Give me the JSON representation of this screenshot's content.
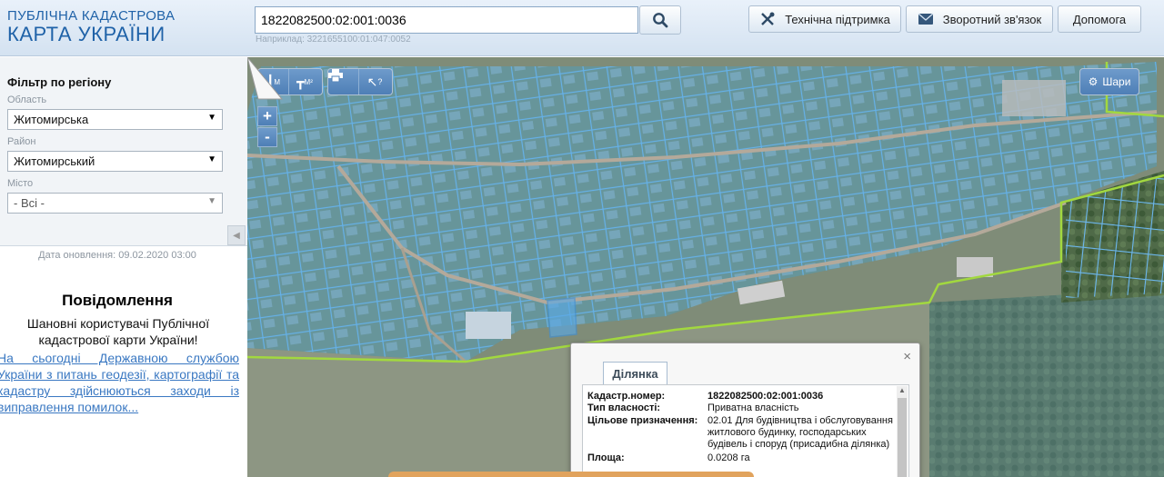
{
  "header": {
    "logo_line1": "ПУБЛІЧНА КАДАСТРОВА",
    "logo_line2": "КАРТА УКРАЇНИ",
    "search_value": "1822082500:02:001:0036",
    "search_hint": "Наприклад: 3221655100:01:047:0052",
    "support_label": "Технічна підтримка",
    "feedback_label": "Зворотний зв'язок",
    "help_label": "Допомога"
  },
  "sidebar": {
    "filter_title": "Фільтр по регіону",
    "oblast_label": "Область",
    "oblast_value": "Житомирська",
    "raion_label": "Район",
    "raion_value": "Житомирський",
    "misto_label": "Місто",
    "misto_value": "- Всі -",
    "update_date": "Дата оновлення: 09.02.2020 03:00",
    "message_title": "Повідомлення",
    "message_text": "Шановні користувачі Публічної кадастрової карти України!",
    "message_link": "На сьогодні Державною службою України з питань геодезії, картографії та кадастру здійснюються заходи із виправлення помилок..."
  },
  "map": {
    "tools": {
      "measure_m": "М",
      "measure_m2": "М²",
      "help": "?"
    },
    "zoom_in": "+",
    "zoom_out": "-",
    "layers_label": "Шари"
  },
  "popup": {
    "tab_label": "Ділянка",
    "close": "×",
    "rows": [
      {
        "key": "Кадастр.номер:",
        "value": "1822082500:02:001:0036"
      },
      {
        "key": "Тип власності:",
        "value": "Приватна власність"
      },
      {
        "key": "Цільове призначення:",
        "value": "02.01 Для будівництва і обслуговування житлового будинку, господарських будівель і споруд (присадибна ділянка)"
      },
      {
        "key": "Площа:",
        "value": "0.0208 га"
      }
    ]
  },
  "colors": {
    "brand_blue": "#1f62a8",
    "parcel_blue": "#5aa9e6",
    "boundary_green": "#9ccc3a"
  },
  "icons": {
    "search": "search-icon",
    "support": "tools-icon",
    "feedback": "envelope-icon",
    "print": "print-icon",
    "layers": "gear-icon"
  }
}
